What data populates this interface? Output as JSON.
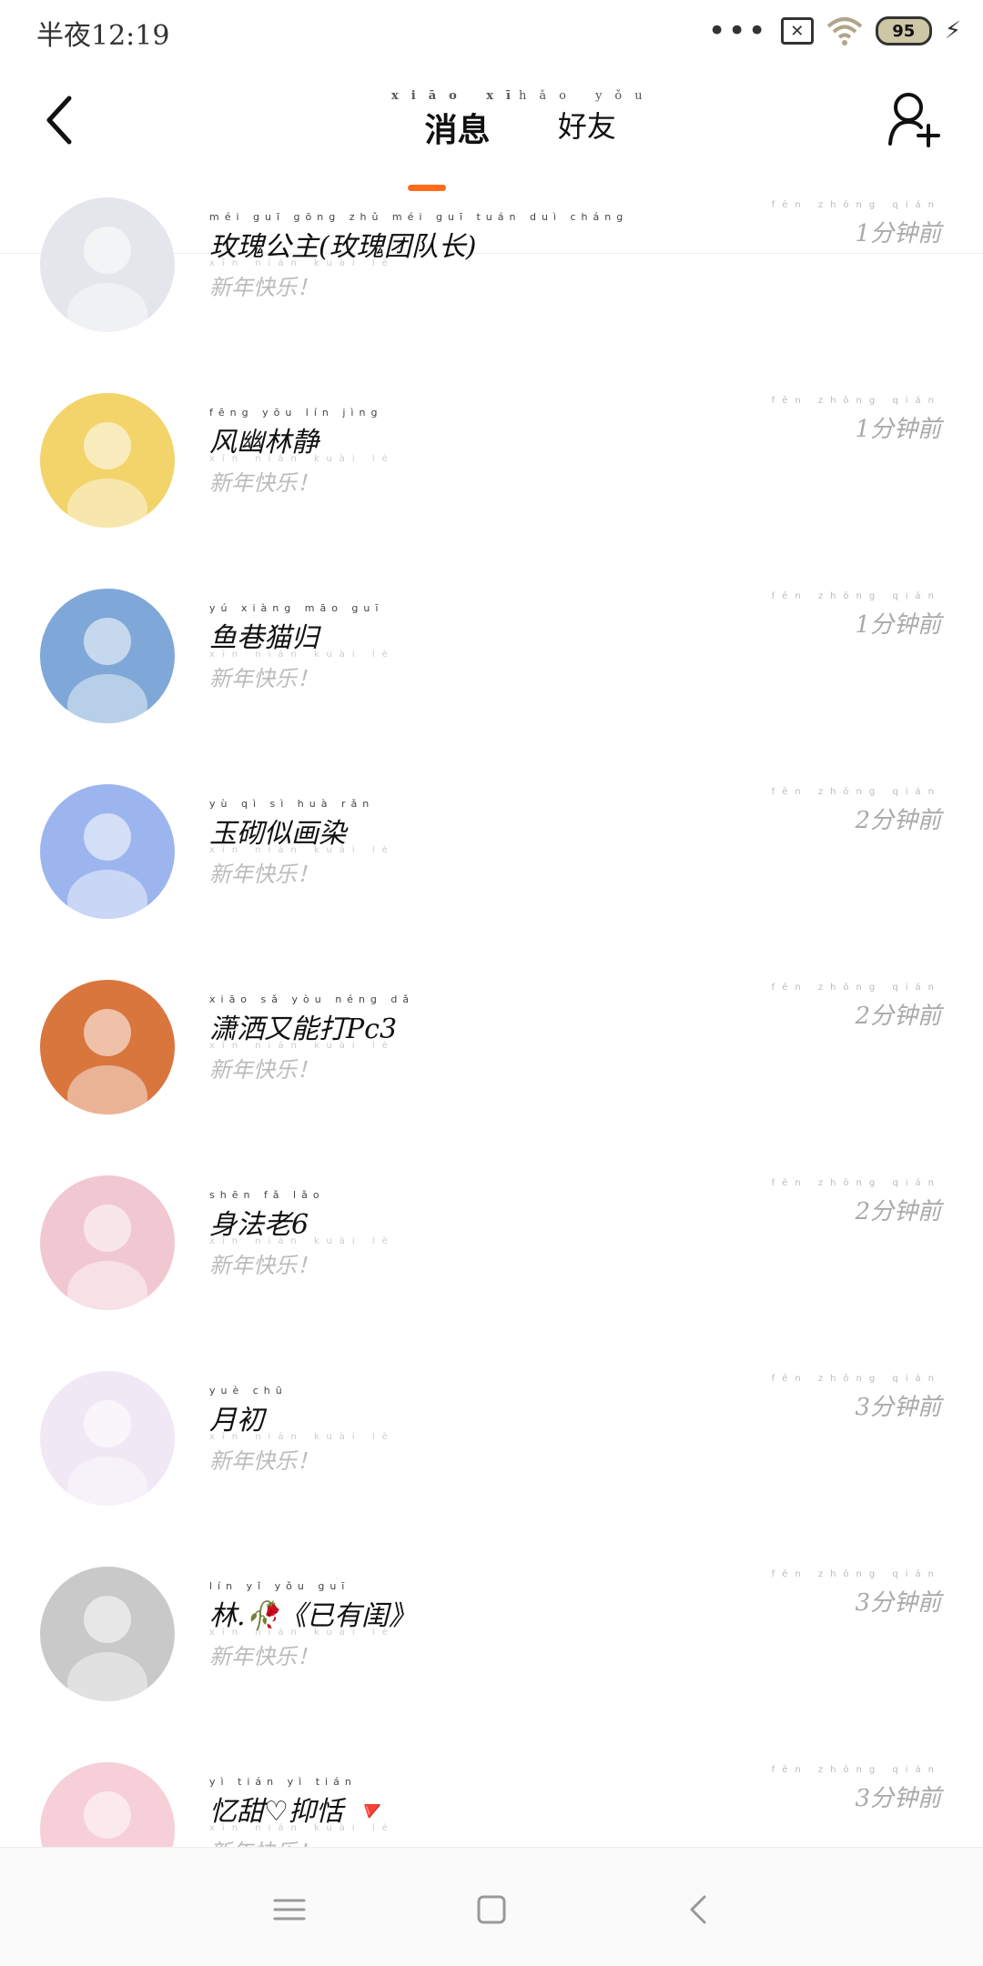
{
  "status": {
    "time": "半夜12:19",
    "battery": "95"
  },
  "header": {
    "tabs": [
      {
        "label": "消息",
        "pinyin": "xiāo xī",
        "active": true
      },
      {
        "label": "好友",
        "pinyin": "hǎo yǒu",
        "active": false
      }
    ]
  },
  "conversations": [
    {
      "name": "玫瑰公主(玫瑰团队长)",
      "name_pinyin": "méi guī gōng zhǔ méi guī tuán duì cháng",
      "message": "新年快乐！",
      "message_pinyin": "xīn nián kuài lè",
      "time": "1分钟前",
      "time_pinyin": "fēn zhōng qián",
      "avatar_bg": "#e4e6ec"
    },
    {
      "name": "风幽林静",
      "name_pinyin": "fēng yōu lín jìng",
      "message": "新年快乐！",
      "message_pinyin": "xīn nián kuài lè",
      "time": "1分钟前",
      "time_pinyin": "fēn zhōng qián",
      "avatar_bg": "#f2d46a"
    },
    {
      "name": "鱼巷猫归",
      "name_pinyin": "yú xiàng māo guī",
      "message": "新年快乐！",
      "message_pinyin": "xīn nián kuài lè",
      "time": "1分钟前",
      "time_pinyin": "fēn zhōng qián",
      "avatar_bg": "#7fa8d8"
    },
    {
      "name": "玉砌似画染",
      "name_pinyin": "yù qì sì huà rǎn",
      "message": "新年快乐！",
      "message_pinyin": "xīn nián kuài lè",
      "time": "2分钟前",
      "time_pinyin": "fēn zhōng qián",
      "avatar_bg": "#9db5ee"
    },
    {
      "name": "潇洒又能打Pc3",
      "name_pinyin": "xiāo sǎ yòu néng dǎ",
      "message": "新年快乐！",
      "message_pinyin": "xīn nián kuài lè",
      "time": "2分钟前",
      "time_pinyin": "fēn zhōng qián",
      "avatar_bg": "#d9763e"
    },
    {
      "name": "身法老6",
      "name_pinyin": "shēn fǎ lǎo",
      "message": "新年快乐！",
      "message_pinyin": "xīn nián kuài lè",
      "time": "2分钟前",
      "time_pinyin": "fēn zhōng qián",
      "avatar_bg": "#f1c8d2"
    },
    {
      "name": "月初",
      "name_pinyin": "yuè chū",
      "message": "新年快乐！",
      "message_pinyin": "xīn nián kuài lè",
      "time": "3分钟前",
      "time_pinyin": "fēn zhōng qián",
      "avatar_bg": "#f1e8f6"
    },
    {
      "name": "林.🥀《已有闺》",
      "name_pinyin": "lín yǐ yǒu guī",
      "message": "新年快乐！",
      "message_pinyin": "xīn nián kuài lè",
      "time": "3分钟前",
      "time_pinyin": "fēn zhōng qián",
      "avatar_bg": "#c9c9c9"
    },
    {
      "name": "忆甜♡抑恬 🔻",
      "name_pinyin": "yì tián yì tián",
      "message": "新年快乐！",
      "message_pinyin": "xīn nián kuài lè",
      "time": "3分钟前",
      "time_pinyin": "fēn zhōng qián",
      "avatar_bg": "#f6cfd8"
    }
  ],
  "colors": {
    "accent": "#ff6a1a",
    "secondary_text": "#bbbbbb"
  }
}
